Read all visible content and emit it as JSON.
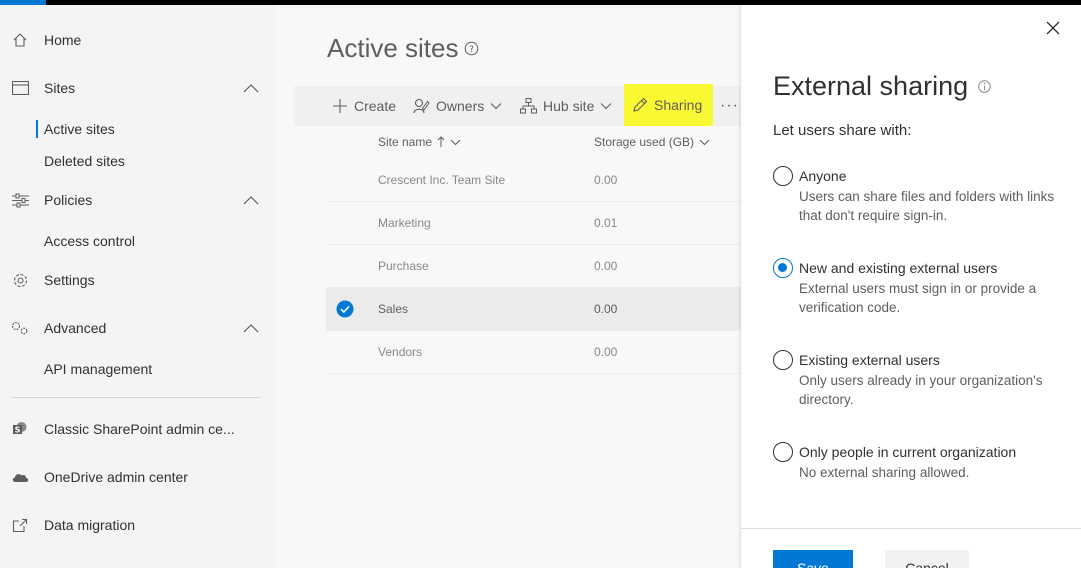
{
  "colors": {
    "accent": "#0078d4",
    "highlight": "#f9f933",
    "nav_bg": "#f4f4f4",
    "main_bg": "#f8f8f8"
  },
  "nav": {
    "home": "Home",
    "sites": "Sites",
    "active_sites": "Active sites",
    "deleted_sites": "Deleted sites",
    "policies": "Policies",
    "access_control": "Access control",
    "settings": "Settings",
    "advanced": "Advanced",
    "api_management": "API management",
    "classic_admin": "Classic SharePoint admin ce...",
    "onedrive_admin": "OneDrive admin center",
    "data_migration": "Data migration"
  },
  "main": {
    "title": "Active sites",
    "commands": {
      "create": "Create",
      "owners": "Owners",
      "hub_site": "Hub site",
      "sharing": "Sharing",
      "more": "···"
    },
    "columns": {
      "site_name": "Site name",
      "storage": "Storage used (GB)"
    },
    "rows": [
      {
        "name": "Crescent Inc. Team Site",
        "storage": "0.00",
        "selected": false
      },
      {
        "name": "Marketing",
        "storage": "0.01",
        "selected": false
      },
      {
        "name": "Purchase",
        "storage": "0.00",
        "selected": false
      },
      {
        "name": "Sales",
        "storage": "0.00",
        "selected": true
      },
      {
        "name": "Vendors",
        "storage": "0.00",
        "selected": false
      }
    ]
  },
  "panel": {
    "title": "External sharing",
    "subtitle": "Let users share with:",
    "options": [
      {
        "label": "Anyone",
        "desc": "Users can share files and folders with links that don't require sign-in.",
        "checked": false
      },
      {
        "label": "New and existing external users",
        "desc": "External users must sign in or provide a verification code.",
        "checked": true
      },
      {
        "label": "Existing external users",
        "desc": "Only users already in your organization's directory.",
        "checked": false
      },
      {
        "label": "Only people in current organization",
        "desc": "No external sharing allowed.",
        "checked": false
      }
    ],
    "save": "Save",
    "cancel": "Cancel"
  }
}
